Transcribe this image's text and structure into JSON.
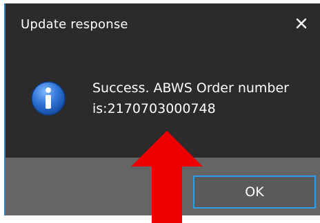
{
  "dialog": {
    "title": "Update response",
    "close_glyph": "✕",
    "message_line1": "Success. ABWS Order number",
    "message_line2": "is:2170703000748",
    "ok_label": "OK",
    "icon": "info-icon",
    "annotation": "red-arrow-up"
  },
  "colors": {
    "dialog_bg": "#2b2b2b",
    "footer_bg": "#656565",
    "accent": "#2e9ee6",
    "info_blue": "#1b63c4",
    "arrow_red": "#ee0000"
  }
}
